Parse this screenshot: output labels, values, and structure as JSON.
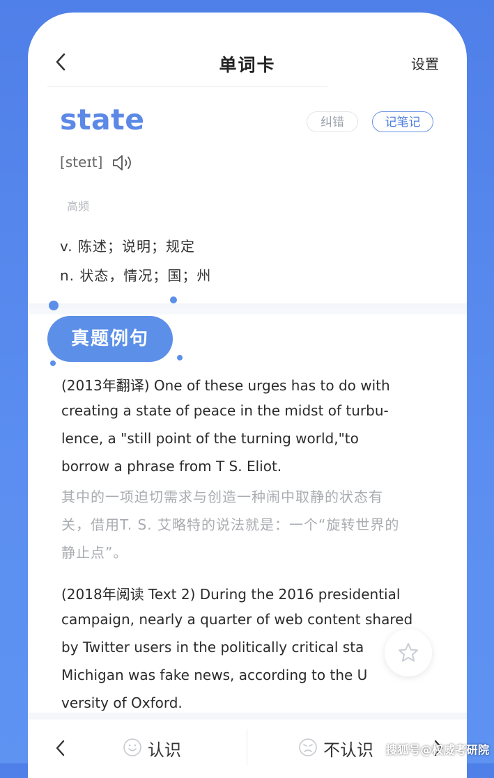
{
  "header": {
    "title": "单词卡",
    "settings_label": "设置"
  },
  "word": {
    "headword": "state",
    "phonetic": "[steɪt]",
    "correct_label": "纠错",
    "note_label": "记笔记",
    "frequency_tag": "高频",
    "definitions": [
      "v. 陈述；说明；规定",
      "n. 状态，情况；国；州"
    ]
  },
  "examples": {
    "section_title": "真题例句",
    "items": [
      {
        "en_lines": [
          "(2013年翻译) One of these urges has to do with",
          "creating a state of peace in the midst of turbu-",
          "lence, a \"still point of the turning world,\"to",
          "borrow a phrase from T  S. Eliot."
        ],
        "zh_lines": [
          "其中的一项迫切需求与创造一种闹中取静的状态有",
          "关，借用T. S. 艾略特的说法就是：一个“旋转世界的",
          "静止点”。"
        ]
      },
      {
        "en_lines": [
          "(2018年阅读 Text 2) During the 2016 presidential",
          "campaign, nearly a quarter of web content shared",
          "by Twitter users in the politically critical sta",
          "Michigan was fake news, according to the U",
          "versity of Oxford."
        ]
      }
    ]
  },
  "bottom_bar": {
    "known_label": "认识",
    "unknown_label": "不认识"
  },
  "watermark": "搜狐号@权威考研院",
  "colors": {
    "accent": "#5b8fe8",
    "headword": "#5c89e6",
    "background": "#4f7fe8"
  }
}
